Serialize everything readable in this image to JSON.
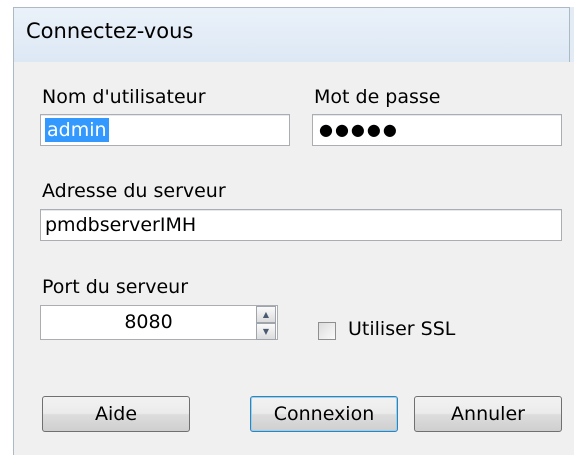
{
  "dialog": {
    "title": "Connectez-vous"
  },
  "fields": {
    "username_label": "Nom d'utilisateur",
    "username_value": "admin",
    "password_label": "Mot de passe",
    "password_value": "●●●●●",
    "server_address_label": "Adresse du serveur",
    "server_address_value": "pmdbserverIMH",
    "server_port_label": "Port du serveur",
    "server_port_value": "8080",
    "ssl_label": "Utiliser SSL",
    "ssl_checked": false
  },
  "buttons": {
    "help": "Aide",
    "connect": "Connexion",
    "cancel": "Annuler"
  },
  "icons": {
    "spin_up": "chevron-up-icon",
    "spin_down": "chevron-down-icon"
  }
}
